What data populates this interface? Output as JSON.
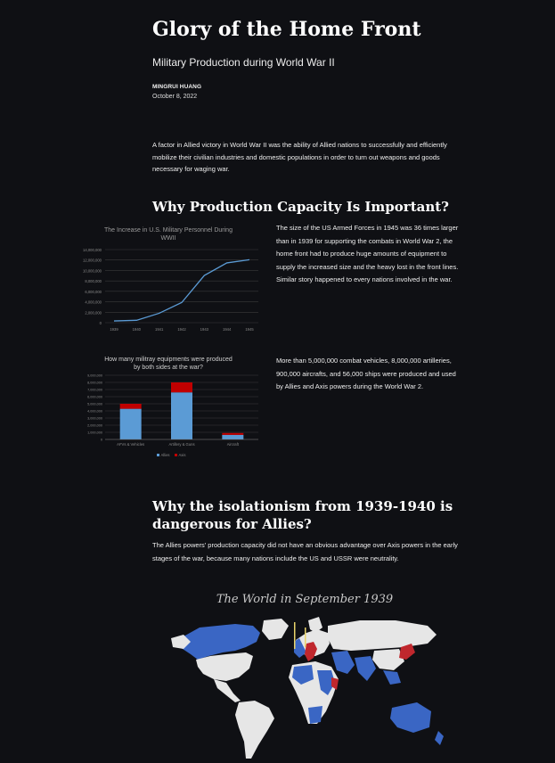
{
  "article": {
    "title": "Glory of the Home Front",
    "subtitle": "Military Production during World War II",
    "author": "MINGRUI HUANG",
    "date": "October 8, 2022",
    "intro": "A factor in Allied victory in World War II was the ability of Allied nations to successfully and efficiently mobilize their civilian industries and domestic populations in order to turn out weapons and goods necessary for waging war."
  },
  "section1": {
    "heading": "Why Production Capacity Is Important?",
    "para1": "The size of the US Armed Forces in 1945 was 36 times larger than in 1939 for supporting the combats in World War 2, the home front had to produce huge amounts of equipment to supply the increased size and the heavy lost in the front lines. Similar story happened to every nations involved in the war.",
    "para2": "More than 5,000,000 combat vehicles, 8,000,000 artilleries, 900,000 aircrafts, and 56,000 ships were produced and used by Allies and Axis powers during the World War 2."
  },
  "section2": {
    "heading": "Why the isolationism from 1939-1940 is dangerous for Allies?",
    "para": "The Allies powers' production capacity did not have an obvious advantage over Axis powers in the early stages of the war, because many nations include the US and USSR were neutrality.",
    "map_title": "The World in September 1939"
  },
  "colors": {
    "background": "#0f1014",
    "line": "#5b9bd5",
    "allies": "#5b9bd5",
    "axis": "#c00000",
    "map_allies": "#3a66c4",
    "map_axis": "#c0272d",
    "map_neutral": "#e6e6e6"
  },
  "chart_data": [
    {
      "type": "line",
      "title": "The Increase in U.S. Military Personnel During WWII",
      "x": [
        "1939",
        "1940",
        "1941",
        "1942",
        "1943",
        "1944",
        "1945"
      ],
      "series": [
        {
          "values": [
            334473,
            458365,
            1801101,
            3858791,
            9044745,
            11451719,
            12055884
          ]
        }
      ],
      "ylim": [
        0,
        14000000
      ],
      "yticks": [
        "0",
        "2,000,000",
        "4,000,000",
        "6,000,000",
        "8,000,000",
        "10,000,000",
        "12,000,000",
        "14,000,000"
      ],
      "grid": true
    },
    {
      "type": "bar",
      "stacked": true,
      "title": "How many militray equipments were produced by both sides at the war?",
      "categories": [
        "AFVs & Vehicles",
        "Artillery & Guns",
        "Aircraft"
      ],
      "series": [
        {
          "name": "Allies",
          "values": [
            4300000,
            6600000,
            640000
          ]
        },
        {
          "name": "Axis",
          "values": [
            700000,
            1400000,
            260000
          ]
        }
      ],
      "ylim": [
        0,
        9000000
      ],
      "yticks": [
        "0",
        "1,000,000",
        "2,000,000",
        "3,000,000",
        "4,000,000",
        "5,000,000",
        "6,000,000",
        "7,000,000",
        "8,000,000",
        "9,000,000"
      ],
      "legend": "bottom",
      "grid": true
    }
  ]
}
